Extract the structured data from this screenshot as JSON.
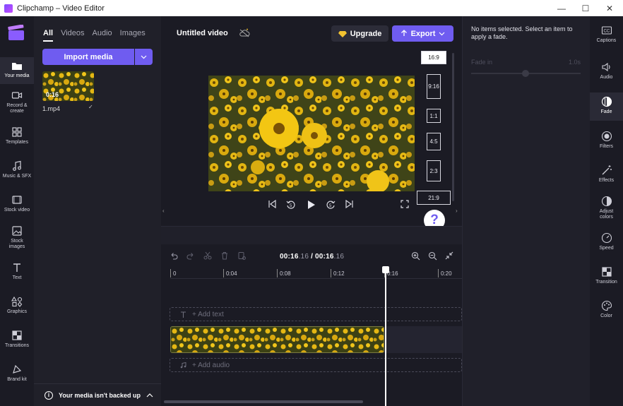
{
  "window": {
    "title": "Clipchamp – Video Editor",
    "controls": {
      "minimize": "—",
      "maximize": "☐",
      "close": "✕"
    }
  },
  "leftrail": {
    "items": [
      {
        "label": "Your media",
        "icon": "folder-icon"
      },
      {
        "label": "Record & create",
        "icon": "video-camera-icon"
      },
      {
        "label": "Templates",
        "icon": "templates-icon"
      },
      {
        "label": "Music & SFX",
        "icon": "music-note-icon"
      },
      {
        "label": "Stock video",
        "icon": "film-icon"
      },
      {
        "label": "Stock images",
        "icon": "image-icon"
      },
      {
        "label": "Text",
        "icon": "text-icon"
      },
      {
        "label": "Graphics",
        "icon": "shapes-icon"
      },
      {
        "label": "Transitions",
        "icon": "transition-icon"
      },
      {
        "label": "Brand kit",
        "icon": "brand-kit-icon"
      }
    ]
  },
  "media": {
    "tabs": [
      "All",
      "Videos",
      "Audio",
      "Images"
    ],
    "import_label": "Import media",
    "items": [
      {
        "duration": "0:16",
        "name": "1.mp4"
      }
    ],
    "backup_notice": "Your media isn't backed up"
  },
  "preview": {
    "video_title": "Untitled video",
    "upgrade_label": "Upgrade",
    "export_label": "Export",
    "aspect_ratios": [
      "16:9",
      "9:16",
      "1:1",
      "4:5",
      "2:3",
      "21:9"
    ],
    "selected_ratio": "16:9",
    "help_label": "?"
  },
  "timeline": {
    "current_time_main": "00:16",
    "current_time_frac": ".16",
    "total_time_main": "00:16",
    "total_time_frac": ".16",
    "separator": " / ",
    "ruler_ticks": [
      "0",
      "0:04",
      "0:08",
      "0:12",
      "0:16",
      "0:20"
    ],
    "add_text_label": "+ Add text",
    "add_audio_label": "+ Add audio"
  },
  "properties": {
    "message": "No items selected. Select an item to apply a fade.",
    "fade_in_label": "Fade in",
    "fade_in_value": "1.0s"
  },
  "rightrail": {
    "items": [
      {
        "label": "Captions",
        "icon": "captions-icon"
      },
      {
        "label": "Audio",
        "icon": "speaker-icon"
      },
      {
        "label": "Fade",
        "icon": "fade-icon"
      },
      {
        "label": "Filters",
        "icon": "filters-icon"
      },
      {
        "label": "Effects",
        "icon": "magic-wand-icon"
      },
      {
        "label": "Adjust colors",
        "icon": "adjust-colors-icon"
      },
      {
        "label": "Speed",
        "icon": "speedometer-icon"
      },
      {
        "label": "Transition",
        "icon": "transition-icon"
      },
      {
        "label": "Color",
        "icon": "palette-icon"
      }
    ],
    "active": "Fade"
  },
  "colors": {
    "accent": "#6f5cf0",
    "background": "#1b1b24",
    "panel": "#202029"
  }
}
